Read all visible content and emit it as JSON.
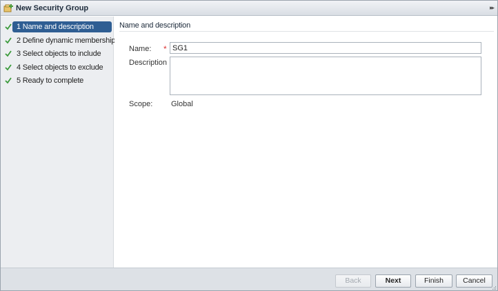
{
  "window": {
    "title": "New Security Group",
    "icon": "security-group-add-icon",
    "collapse_icon": "double-chevron-right-icon"
  },
  "steps": [
    {
      "label": "1  Name and description",
      "completed": true,
      "active": true
    },
    {
      "label": "2  Define dynamic membership",
      "completed": true,
      "active": false
    },
    {
      "label": "3  Select objects to include",
      "completed": true,
      "active": false
    },
    {
      "label": "4  Select objects to exclude",
      "completed": true,
      "active": false
    },
    {
      "label": "5  Ready to complete",
      "completed": true,
      "active": false
    }
  ],
  "main": {
    "section_title": "Name and description",
    "name_label": "Name:",
    "name_required_mark": "*",
    "name_value": "SG1",
    "description_label": "Description",
    "description_value": "",
    "scope_label": "Scope:",
    "scope_value": "Global"
  },
  "footer": {
    "back_label": "Back",
    "next_label": "Next",
    "finish_label": "Finish",
    "cancel_label": "Cancel",
    "back_enabled": false
  },
  "colors": {
    "active_step_bg": "#2f5e93",
    "check_green": "#3a9a3a",
    "required_red": "#dd3333"
  }
}
